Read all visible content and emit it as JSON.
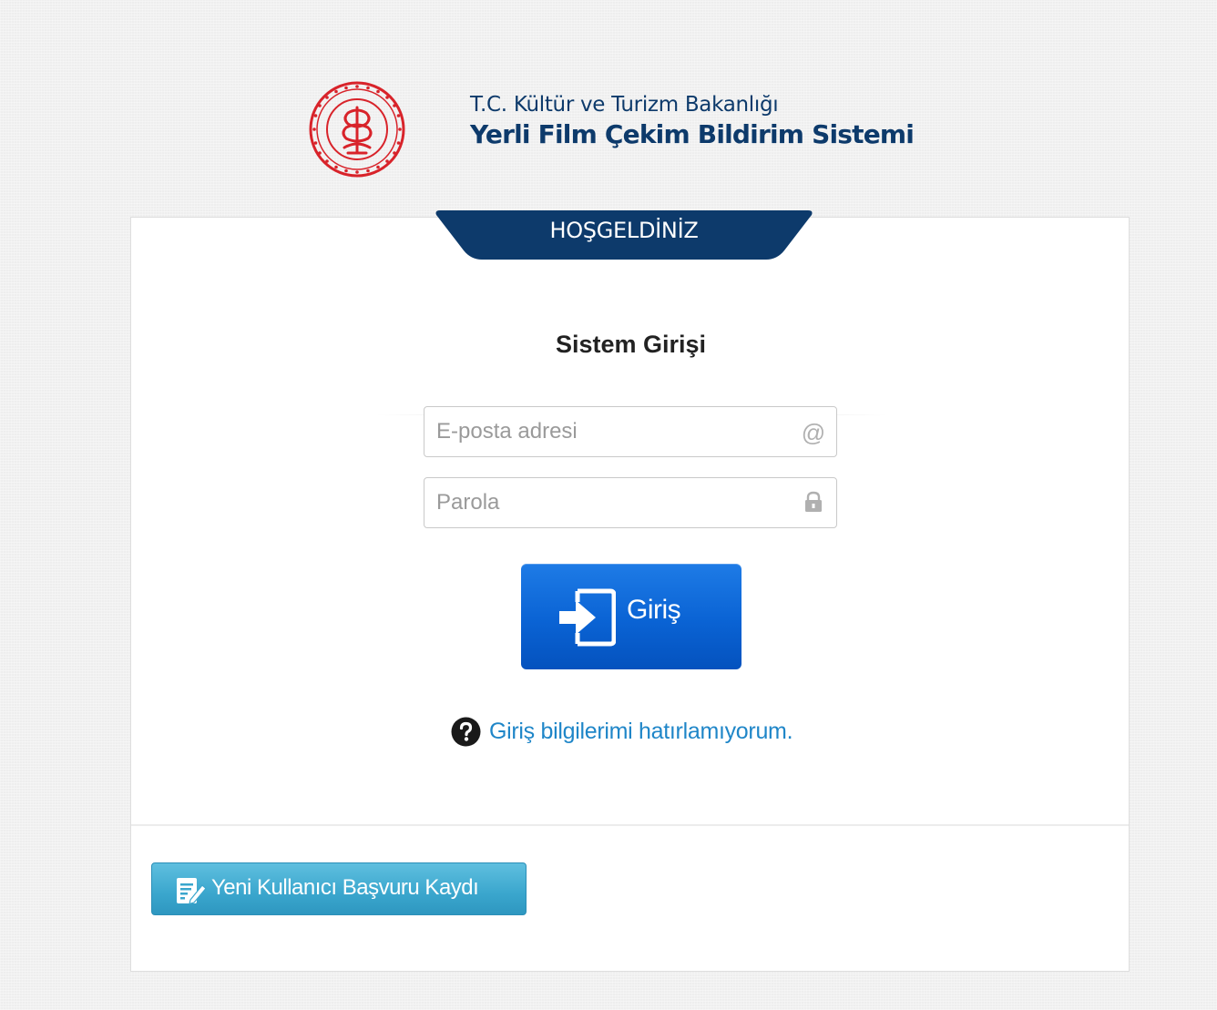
{
  "header": {
    "ministry": "T.C. Kültür ve Turizm Bakanlığı",
    "system_name": "Yerli Film Çekim Bildirim Sistemi",
    "logo_icon": "ministry-seal-icon"
  },
  "card": {
    "welcome": "HOŞGELDİNİZ",
    "title": "Sistem Girişi",
    "email": {
      "placeholder": "E-posta adresi",
      "value": "",
      "icon": "at-icon"
    },
    "password": {
      "placeholder": "Parola",
      "value": "",
      "icon": "lock-icon"
    },
    "login_button": {
      "label": "Giriş",
      "icon": "sign-in-icon"
    },
    "forgot": {
      "label": "Giriş bilgilerimi hatırlamıyorum.",
      "icon": "question-circle-icon"
    },
    "register_button": {
      "label": "Yeni Kullanıcı Başvuru Kaydı",
      "icon": "edit-document-icon"
    }
  },
  "colors": {
    "brand_navy": "#0d3a6b",
    "emblem_red": "#d8232a",
    "login_blue": "#0a63d4",
    "link_blue": "#1f86c8",
    "register_teal": "#3aa6cd"
  }
}
